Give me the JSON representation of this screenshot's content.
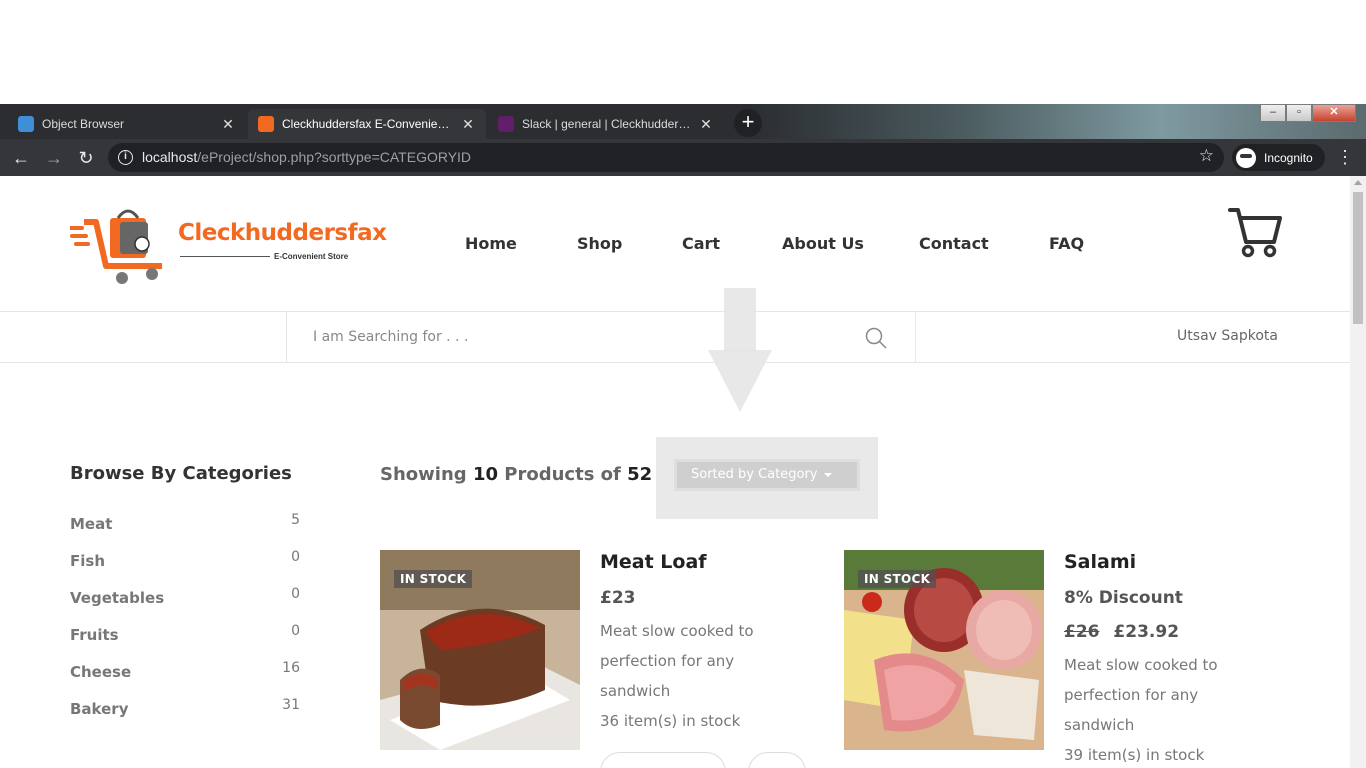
{
  "browser": {
    "tabs": [
      {
        "title": "Object Browser",
        "active": false
      },
      {
        "title": "Cleckhuddersfax E-Convenient St",
        "active": true
      },
      {
        "title": "Slack | general | Cleckhuddersfax",
        "active": false
      }
    ],
    "url_host": "localhost",
    "url_path": "/eProject/shop.php?sorttype=CATEGORYID",
    "profile_label": "Incognito"
  },
  "site": {
    "brand": "Cleckhuddersfax",
    "tagline": "E-Convenient Store",
    "nav": [
      "Home",
      "Shop",
      "Cart",
      "About Us",
      "Contact",
      "FAQ"
    ],
    "search_placeholder": "I am Searching for . . .",
    "user_name": "Utsav Sapkota"
  },
  "sidebar": {
    "title": "Browse By Categories",
    "categories": [
      {
        "name": "Meat",
        "count": "5"
      },
      {
        "name": "Fish",
        "count": "0"
      },
      {
        "name": "Vegetables",
        "count": "0"
      },
      {
        "name": "Fruits",
        "count": "0"
      },
      {
        "name": "Cheese",
        "count": "16"
      },
      {
        "name": "Bakery",
        "count": "31"
      }
    ]
  },
  "listing": {
    "showing_prefix": "Showing",
    "showing_count": "10",
    "showing_middle": "Products of",
    "total": "52",
    "sort_label": "Sorted by Category"
  },
  "products": [
    {
      "name": "Meat Loaf",
      "badge": "IN STOCK",
      "price": "£23",
      "description": "Meat slow cooked to perfection for any sandwich",
      "stock": "36 item(s) in stock"
    },
    {
      "name": "Salami",
      "badge": "IN STOCK",
      "discount": "8% Discount",
      "old_price": "£26",
      "price": "£23.92",
      "description": "Meat slow cooked to perfection for any sandwich",
      "stock": "39 item(s) in stock"
    }
  ],
  "colors": {
    "brand_orange": "#f26a21",
    "chrome_dark": "#35363a"
  }
}
